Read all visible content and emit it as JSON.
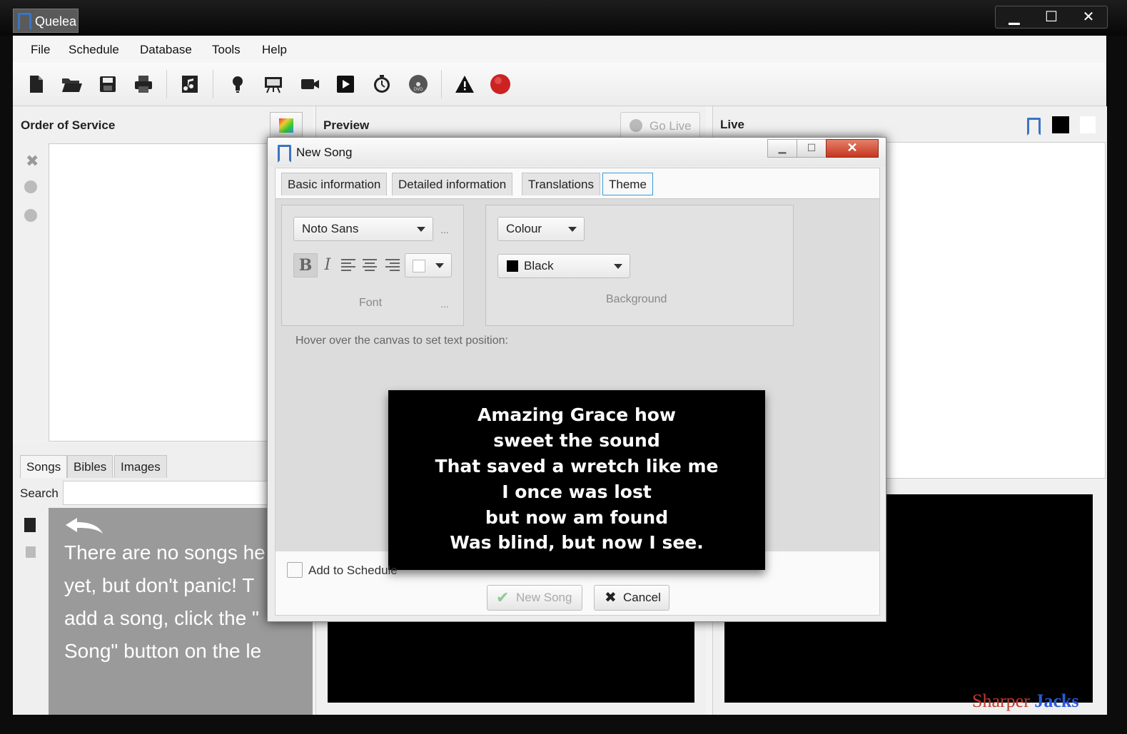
{
  "window": {
    "title": "Quelea",
    "controls": {
      "minimize": "▁",
      "maximize": "☐",
      "close": "✕"
    }
  },
  "menu": [
    "File",
    "Schedule",
    "Database",
    "Tools",
    "Help"
  ],
  "toolbar_icons": [
    "new-schedule-icon",
    "open-schedule-icon",
    "save-schedule-icon",
    "print-icon",
    "new-song-icon",
    "notice-icon",
    "presentation-icon",
    "video-icon",
    "multimedia-icon",
    "timer-icon",
    "dvd-icon",
    "warning-icon",
    "record-icon"
  ],
  "order_of_service": {
    "title": "Order of Service"
  },
  "preview": {
    "title": "Preview",
    "go_live": "Go Live"
  },
  "live": {
    "title": "Live"
  },
  "library": {
    "tabs": [
      "Songs",
      "Bibles",
      "Images"
    ],
    "search_label": "Search",
    "search_value": "",
    "empty_message_lines": [
      "There are no songs he",
      "yet, but don't panic! T",
      "add a song, click the \"",
      "Song\" button on the le"
    ]
  },
  "dialog": {
    "title": "New Song",
    "tabs": [
      "Basic information",
      "Detailed information",
      "Translations",
      "Theme"
    ],
    "active_tab": "Theme",
    "font": {
      "family": "Noto Sans",
      "more": "...",
      "bold": "B",
      "italic": "I",
      "group_label": "Font",
      "group_more": "..."
    },
    "background": {
      "type": "Colour",
      "color_name": "Black",
      "color_hex": "#000000",
      "group_label": "Background"
    },
    "hover_hint": "Hover over the canvas to set text position:",
    "lyrics": [
      "Amazing Grace how",
      "sweet the sound",
      "That saved a wretch like me",
      "I once was lost",
      "but now am found",
      "Was blind, but now I see."
    ],
    "add_to_schedule": "Add to Schedule",
    "add_to_schedule_checked": false,
    "new_song_button": "New Song",
    "cancel_button": "Cancel"
  },
  "watermark": {
    "part1": "Sharper",
    "part2": "Jacks",
    "color1": "#c0392b",
    "color2": "#2a5bd7"
  }
}
